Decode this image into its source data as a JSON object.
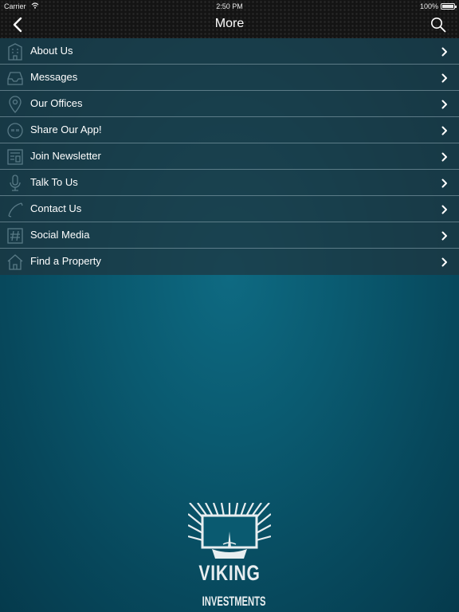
{
  "status_bar": {
    "carrier": "Carrier",
    "time": "2:50 PM",
    "battery": "100%"
  },
  "nav": {
    "title": "More",
    "back_icon": "chevron-left-icon",
    "search_icon": "search-icon"
  },
  "menu": {
    "items": [
      {
        "label": "About Us",
        "icon": "building-icon"
      },
      {
        "label": "Messages",
        "icon": "inbox-icon"
      },
      {
        "label": "Our Offices",
        "icon": "map-pin-icon"
      },
      {
        "label": "Share Our App!",
        "icon": "share-bubble-icon"
      },
      {
        "label": "Join Newsletter",
        "icon": "newsletter-icon"
      },
      {
        "label": "Talk To Us",
        "icon": "microphone-icon"
      },
      {
        "label": "Contact Us",
        "icon": "phone-icon"
      },
      {
        "label": "Social Media",
        "icon": "hashtag-icon"
      },
      {
        "label": "Find a Property",
        "icon": "house-icon"
      }
    ]
  },
  "logo": {
    "line1": "VIKING",
    "line2": "INVESTMENTS"
  },
  "colors": {
    "background": "#0a5a70",
    "nav_bar": "#141414",
    "menu_background": "#1e343e",
    "text": "#ffffff"
  }
}
